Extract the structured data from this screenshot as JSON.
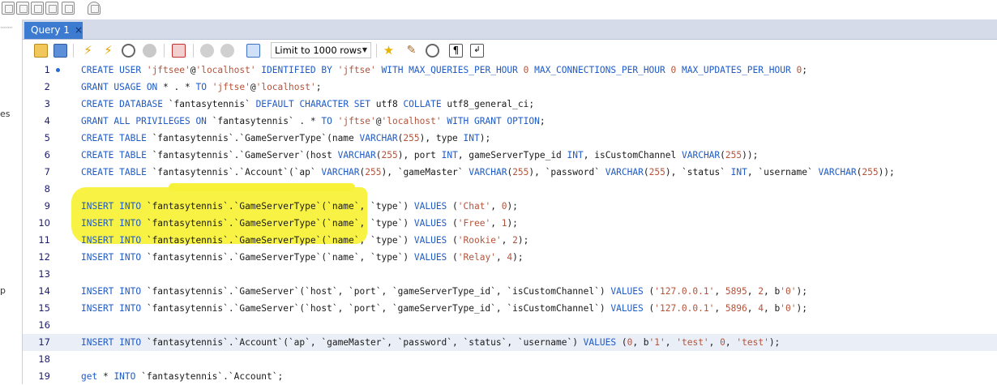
{
  "tab": {
    "label": "Query 1",
    "close": "×"
  },
  "toolbar": {
    "limit_label": "Limit to 1000 rows"
  },
  "left_panel": {
    "labels": [
      "es",
      "p"
    ]
  },
  "lines": [
    {
      "n": "1",
      "tokens": [
        [
          "k",
          "CREATE USER "
        ],
        [
          "s",
          "'jftsee'"
        ],
        [
          "",
          "@"
        ],
        [
          "s",
          "'localhost'"
        ],
        [
          "k",
          " IDENTIFIED BY "
        ],
        [
          "s",
          "'jftse'"
        ],
        [
          "k",
          " WITH MAX_QUERIES_PER_HOUR "
        ],
        [
          "n",
          "0"
        ],
        [
          "k",
          " MAX_CONNECTIONS_PER_HOUR "
        ],
        [
          "n",
          "0"
        ],
        [
          "k",
          " MAX_UPDATES_PER_HOUR "
        ],
        [
          "n",
          "0"
        ],
        [
          "",
          ";"
        ]
      ]
    },
    {
      "n": "2",
      "tokens": [
        [
          "k",
          "GRANT USAGE ON "
        ],
        [
          "",
          "* . * "
        ],
        [
          "k",
          "TO "
        ],
        [
          "s",
          "'jftse'"
        ],
        [
          "",
          "@"
        ],
        [
          "s",
          "'localhost'"
        ],
        [
          "",
          ";"
        ]
      ]
    },
    {
      "n": "3",
      "tokens": [
        [
          "k",
          "CREATE DATABASE "
        ],
        [
          "",
          "`fantasytennis` "
        ],
        [
          "k",
          "DEFAULT CHARACTER SET "
        ],
        [
          "",
          "utf8 "
        ],
        [
          "k",
          "COLLATE "
        ],
        [
          "",
          "utf8_general_ci;"
        ]
      ]
    },
    {
      "n": "4",
      "tokens": [
        [
          "k",
          "GRANT ALL PRIVILEGES ON "
        ],
        [
          "",
          "`fantasytennis` . * "
        ],
        [
          "k",
          "TO "
        ],
        [
          "s",
          "'jftse'"
        ],
        [
          "",
          "@"
        ],
        [
          "s",
          "'localhost'"
        ],
        [
          "k",
          " WITH GRANT OPTION"
        ],
        [
          "",
          ";"
        ]
      ]
    },
    {
      "n": "5",
      "tokens": [
        [
          "k",
          "CREATE TABLE "
        ],
        [
          "",
          "`fantasytennis`.`GameServerType`(name "
        ],
        [
          "k",
          "VARCHAR"
        ],
        [
          "",
          "("
        ],
        [
          "n",
          "255"
        ],
        [
          "",
          "), type "
        ],
        [
          "k",
          "INT"
        ],
        [
          "",
          ");"
        ]
      ]
    },
    {
      "n": "6",
      "tokens": [
        [
          "k",
          "CREATE TABLE "
        ],
        [
          "",
          "`fantasytennis`.`GameServer`(host "
        ],
        [
          "k",
          "VARCHAR"
        ],
        [
          "",
          "("
        ],
        [
          "n",
          "255"
        ],
        [
          "",
          "), port "
        ],
        [
          "k",
          "INT"
        ],
        [
          "",
          ", gameServerType_id "
        ],
        [
          "k",
          "INT"
        ],
        [
          "",
          ", isCustomChannel "
        ],
        [
          "k",
          "VARCHAR"
        ],
        [
          "",
          "("
        ],
        [
          "n",
          "255"
        ],
        [
          "",
          "));"
        ]
      ]
    },
    {
      "n": "7",
      "tokens": [
        [
          "k",
          "CREATE TABLE "
        ],
        [
          "",
          "`fantasytennis`.`Account`(`ap` "
        ],
        [
          "k",
          "VARCHAR"
        ],
        [
          "",
          "("
        ],
        [
          "n",
          "255"
        ],
        [
          "",
          "), `gameMaster` "
        ],
        [
          "k",
          "VARCHAR"
        ],
        [
          "",
          "("
        ],
        [
          "n",
          "255"
        ],
        [
          "",
          "), `password` "
        ],
        [
          "k",
          "VARCHAR"
        ],
        [
          "",
          "("
        ],
        [
          "n",
          "255"
        ],
        [
          "",
          "), `status` "
        ],
        [
          "k",
          "INT"
        ],
        [
          "",
          ", `username` "
        ],
        [
          "k",
          "VARCHAR"
        ],
        [
          "",
          "("
        ],
        [
          "n",
          "255"
        ],
        [
          "",
          "));"
        ]
      ]
    },
    {
      "n": "8",
      "tokens": []
    },
    {
      "n": "9",
      "tokens": [
        [
          "k",
          "INSERT INTO "
        ],
        [
          "",
          "`fantasytennis`.`GameServerType`(`name`, `type`) "
        ],
        [
          "k",
          "VALUES "
        ],
        [
          "",
          "("
        ],
        [
          "s",
          "'Chat'"
        ],
        [
          "",
          ", "
        ],
        [
          "n",
          "0"
        ],
        [
          "",
          ");"
        ]
      ]
    },
    {
      "n": "10",
      "tokens": [
        [
          "k",
          "INSERT INTO "
        ],
        [
          "",
          "`fantasytennis`.`GameServerType`(`name`, `type`) "
        ],
        [
          "k",
          "VALUES "
        ],
        [
          "",
          "("
        ],
        [
          "s",
          "'Free'"
        ],
        [
          "",
          ", "
        ],
        [
          "n",
          "1"
        ],
        [
          "",
          ");"
        ]
      ]
    },
    {
      "n": "11",
      "tokens": [
        [
          "k",
          "INSERT INTO "
        ],
        [
          "",
          "`fantasytennis`.`GameServerType`(`name`, `type`) "
        ],
        [
          "k",
          "VALUES "
        ],
        [
          "",
          "("
        ],
        [
          "s",
          "'Rookie'"
        ],
        [
          "",
          ", "
        ],
        [
          "n",
          "2"
        ],
        [
          "",
          ");"
        ]
      ]
    },
    {
      "n": "12",
      "tokens": [
        [
          "k",
          "INSERT INTO "
        ],
        [
          "",
          "`fantasytennis`.`GameServerType`(`name`, `type`) "
        ],
        [
          "k",
          "VALUES "
        ],
        [
          "",
          "("
        ],
        [
          "s",
          "'Relay'"
        ],
        [
          "",
          ", "
        ],
        [
          "n",
          "4"
        ],
        [
          "",
          ");"
        ]
      ]
    },
    {
      "n": "13",
      "tokens": []
    },
    {
      "n": "14",
      "tokens": [
        [
          "k",
          "INSERT INTO "
        ],
        [
          "",
          "`fantasytennis`.`GameServer`(`host`, `port`, `gameServerType_id`, `isCustomChannel`) "
        ],
        [
          "k",
          "VALUES "
        ],
        [
          "",
          "("
        ],
        [
          "s",
          "'127.0.0.1'"
        ],
        [
          "",
          ", "
        ],
        [
          "n",
          "5895"
        ],
        [
          "",
          ", "
        ],
        [
          "n",
          "2"
        ],
        [
          "",
          ", b"
        ],
        [
          "s",
          "'0'"
        ],
        [
          "",
          ");"
        ]
      ]
    },
    {
      "n": "15",
      "tokens": [
        [
          "k",
          "INSERT INTO "
        ],
        [
          "",
          "`fantasytennis`.`GameServer`(`host`, `port`, `gameServerType_id`, `isCustomChannel`) "
        ],
        [
          "k",
          "VALUES "
        ],
        [
          "",
          "("
        ],
        [
          "s",
          "'127.0.0.1'"
        ],
        [
          "",
          ", "
        ],
        [
          "n",
          "5896"
        ],
        [
          "",
          ", "
        ],
        [
          "n",
          "4"
        ],
        [
          "",
          ", b"
        ],
        [
          "s",
          "'0'"
        ],
        [
          "",
          ");"
        ]
      ]
    },
    {
      "n": "16",
      "tokens": []
    },
    {
      "n": "17",
      "tokens": [
        [
          "k",
          "INSERT INTO "
        ],
        [
          "",
          "`fantasytennis`.`Account`(`ap`, `gameMaster`, `password`, `status`, `username`) "
        ],
        [
          "k",
          "VALUES "
        ],
        [
          "",
          "("
        ],
        [
          "n",
          "0"
        ],
        [
          "",
          ", b"
        ],
        [
          "s",
          "'1'"
        ],
        [
          "",
          ", "
        ],
        [
          "s",
          "'test'"
        ],
        [
          "",
          ", "
        ],
        [
          "n",
          "0"
        ],
        [
          "",
          ", "
        ],
        [
          "s",
          "'test'"
        ],
        [
          "",
          ");"
        ]
      ]
    },
    {
      "n": "18",
      "tokens": []
    },
    {
      "n": "19",
      "tokens": [
        [
          "k",
          "get "
        ],
        [
          "",
          "* "
        ],
        [
          "k",
          "INTO "
        ],
        [
          "",
          "`fantasytennis`.`Account`;"
        ]
      ]
    }
  ]
}
